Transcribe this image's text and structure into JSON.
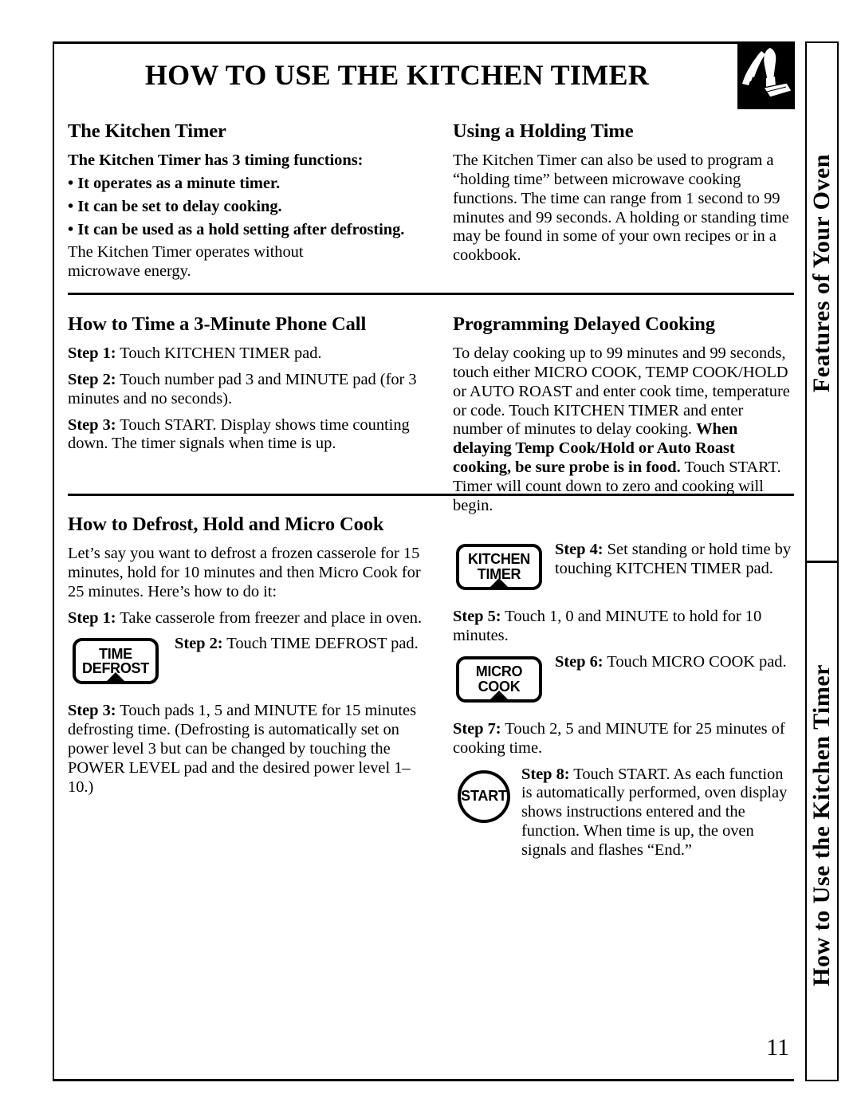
{
  "page": {
    "title": "HOW TO USE THE KITCHEN TIMER",
    "number": "11",
    "header_icon": "hand-pressing-pad-icon"
  },
  "sidebar": {
    "tabs": [
      {
        "label": "Features of Your Oven"
      },
      {
        "label": "How to Use the Kitchen Timer"
      }
    ]
  },
  "sections": {
    "kitchen_timer": {
      "heading": "The Kitchen Timer",
      "intro_bold": "The Kitchen Timer has 3 timing functions:",
      "bullets": [
        "• It operates as a minute timer.",
        "• It can be set to delay cooking.",
        "• It can be used as a hold setting after defrosting."
      ],
      "closing": "The Kitchen Timer operates without microwave energy."
    },
    "holding_time": {
      "heading": "Using a Holding Time",
      "body": "The Kitchen Timer can also be used to program a “holding time” between microwave cooking functions. The time can range from 1 second to 99 minutes and 99 seconds. A holding or standing time may be found in some of your own recipes or in a cookbook."
    },
    "phone_call": {
      "heading": "How to Time a 3-Minute Phone Call",
      "steps": [
        {
          "label": "Step 1:",
          "text": " Touch KITCHEN TIMER pad."
        },
        {
          "label": "Step 2:",
          "text": " Touch number pad 3 and MINUTE pad (for 3 minutes and no seconds)."
        },
        {
          "label": "Step 3:",
          "text": " Touch START. Display shows time counting down. The timer signals when time is up."
        }
      ]
    },
    "delayed_cooking": {
      "heading": "Programming Delayed Cooking",
      "part1": "To delay cooking up to 99 minutes and 99 seconds, touch either MICRO COOK, TEMP COOK/HOLD or AUTO ROAST and enter cook time, temperature or code. Touch KITCHEN TIMER and enter number of minutes to delay cooking. ",
      "part2_bold": "When delaying Temp Cook/Hold or Auto Roast cooking, be sure probe is in food.",
      "part3": " Touch START. Timer will count down to zero and cooking will begin."
    },
    "defrost_hold_micro": {
      "heading": "How to Defrost, Hold and Micro Cook",
      "intro": "Let’s say you want to defrost a frozen casserole for 15 minutes, hold for 10 minutes and then Micro Cook for 25 minutes. Here’s how to do it:",
      "step1_label": "Step 1:",
      "step1_text": " Take casserole from freezer and place in oven.",
      "step2_label": "Step 2:",
      "step2_text": " Touch TIME DEFROST pad.",
      "step3_label": "Step 3:",
      "step3_text": " Touch pads 1, 5 and MINUTE for 15 minutes defrosting time. (Defrosting is automatically set on power level 3 but can be changed by touching the POWER LEVEL pad and the desired power level 1–10.)",
      "step4_label": "Step 4:",
      "step4_text": " Set standing or hold time by touching KITCHEN TIMER pad.",
      "step5_label": "Step 5:",
      "step5_text": " Touch 1, 0 and MINUTE to hold for 10 minutes.",
      "step6_label": "Step 6:",
      "step6_text": " Touch MICRO COOK pad.",
      "step7_label": "Step 7:",
      "step7_text": " Touch 2, 5 and MINUTE for 25 minutes of cooking time.",
      "step8_label": "Step 8:",
      "step8_text": " Touch START. As each function is automatically performed, oven display shows instructions entered and the function. When time is up, the oven signals and flashes “End.”"
    }
  },
  "pads": {
    "time_defrost": {
      "line1": "TIME",
      "line2": "DEFROST"
    },
    "kitchen_timer": {
      "line1": "KITCHEN",
      "line2": "TIMER"
    },
    "micro_cook": {
      "line1": "MICRO",
      "line2": "COOK"
    },
    "start": {
      "label": "START"
    }
  }
}
